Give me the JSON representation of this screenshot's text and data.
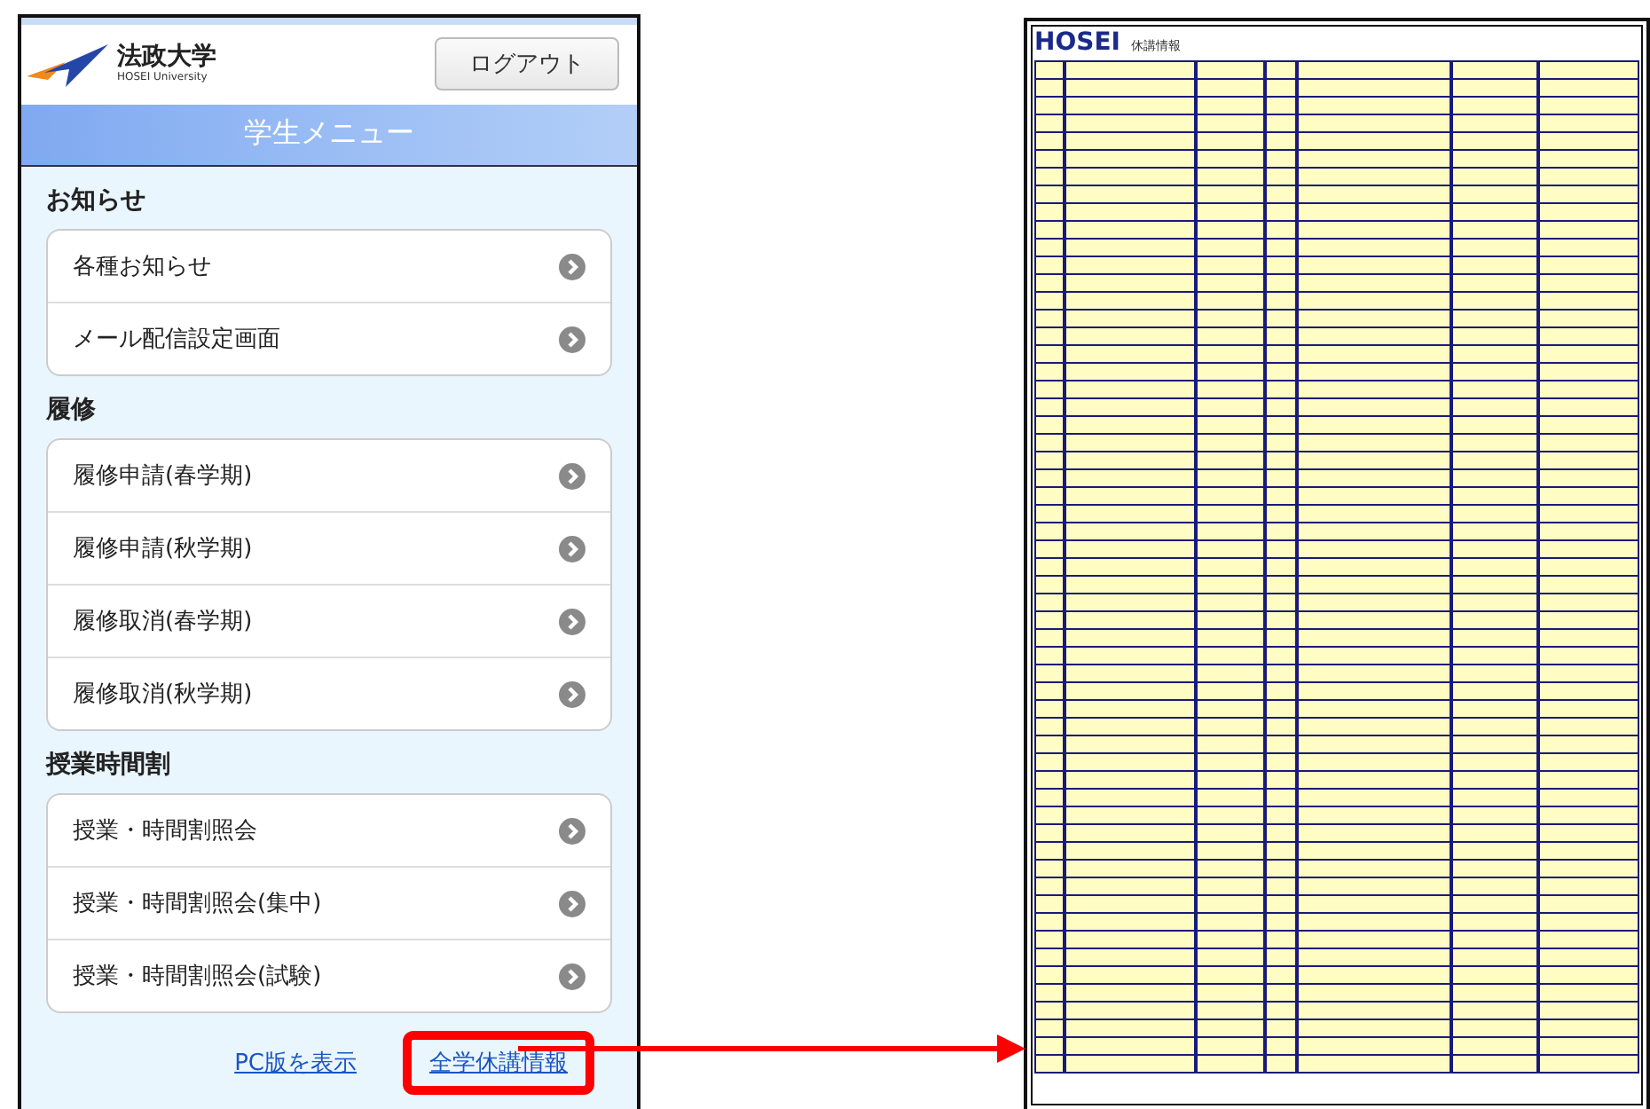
{
  "phone": {
    "logo": {
      "name": "法政大学",
      "subtitle": "HOSEI University"
    },
    "logout_button": "ログアウト",
    "menu_title": "学生メニュー",
    "sections": [
      {
        "heading": "お知らせ",
        "items": [
          "各種お知らせ",
          "メール配信設定画面"
        ]
      },
      {
        "heading": "履修",
        "items": [
          "履修申請(春学期)",
          "履修申請(秋学期)",
          "履修取消(春学期)",
          "履修取消(秋学期)"
        ]
      },
      {
        "heading": "授業時間割",
        "items": [
          "授業・時間割照会",
          "授業・時間割照会(集中)",
          "授業・時間割照会(試験)"
        ]
      }
    ],
    "footer_links": [
      {
        "label": "PC版を表示",
        "highlighted": false
      },
      {
        "label": "全学休講情報",
        "highlighted": true
      }
    ]
  },
  "document": {
    "logo": "HOSEI",
    "title": "休講情報"
  }
}
